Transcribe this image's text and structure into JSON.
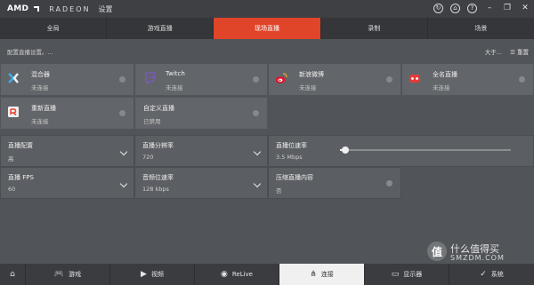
{
  "app": {
    "brand": "AMD",
    "product": "RADEON",
    "title": "设置"
  },
  "window_controls": [
    "refresh-icon",
    "home-icon",
    "help-icon",
    "minimize-icon",
    "restore-icon",
    "close-icon"
  ],
  "window_glyphs": {
    "refresh": "↻",
    "home": "⌂",
    "help": "?",
    "minimize": "–",
    "restore": "❐",
    "close": "✕"
  },
  "tabs": [
    {
      "label": "全局",
      "active": false
    },
    {
      "label": "游戏直播",
      "active": false
    },
    {
      "label": "现场直播",
      "active": true
    },
    {
      "label": "录制",
      "active": false
    },
    {
      "label": "场景",
      "active": false
    }
  ],
  "subheader": {
    "hint": "配置直播设置。...",
    "sort_label": "大于...",
    "reset_label": "重置"
  },
  "services": [
    {
      "name": "混合器",
      "status": "未连接",
      "icon": "mixer-icon"
    },
    {
      "name": "Twitch",
      "status": "未连接",
      "icon": "twitch-icon"
    },
    {
      "name": "新浪微博",
      "status": "未连接",
      "icon": "weibo-icon"
    },
    {
      "name": "全名直播",
      "status": "未连接",
      "icon": "quanmin-icon"
    },
    {
      "name": "重新直播",
      "status": "未连接",
      "icon": "restream-icon"
    },
    {
      "name": "自定义直播",
      "status": "已禁用",
      "icon": ""
    }
  ],
  "settings": {
    "profile": {
      "label": "直播配置",
      "value": "高"
    },
    "resolution": {
      "label": "直播分辨率",
      "value": "720"
    },
    "bitrate": {
      "label": "直播位速率",
      "value": "3.5 Mbps",
      "slider_fraction": 0.03
    },
    "fps": {
      "label": "直播 FPS",
      "value": "60"
    },
    "audio_bitrate": {
      "label": "音频位速率",
      "value": "128 kbps"
    },
    "compress": {
      "label": "压缩直播内容",
      "value": "否"
    }
  },
  "bottom_nav": [
    {
      "label": "",
      "icon": "home-icon",
      "glyph": "⌂",
      "active": false
    },
    {
      "label": "游戏",
      "icon": "gamepad-icon",
      "glyph": "🎮",
      "active": false
    },
    {
      "label": "视频",
      "icon": "play-icon",
      "glyph": "▶",
      "active": false
    },
    {
      "label": "ReLive",
      "icon": "relive-icon",
      "glyph": "◉",
      "active": false
    },
    {
      "label": "连接",
      "icon": "share-icon",
      "glyph": "⋔",
      "active": true
    },
    {
      "label": "显示器",
      "icon": "monitor-icon",
      "glyph": "▭",
      "active": false
    },
    {
      "label": "系统",
      "icon": "check-icon",
      "glyph": "✓",
      "active": false
    }
  ],
  "watermark": {
    "badge": "值",
    "cn": "什么值得买",
    "en": "SMZDM.COM"
  },
  "colors": {
    "accent": "#e0452a",
    "background": "#515458",
    "tile": "#626569"
  }
}
